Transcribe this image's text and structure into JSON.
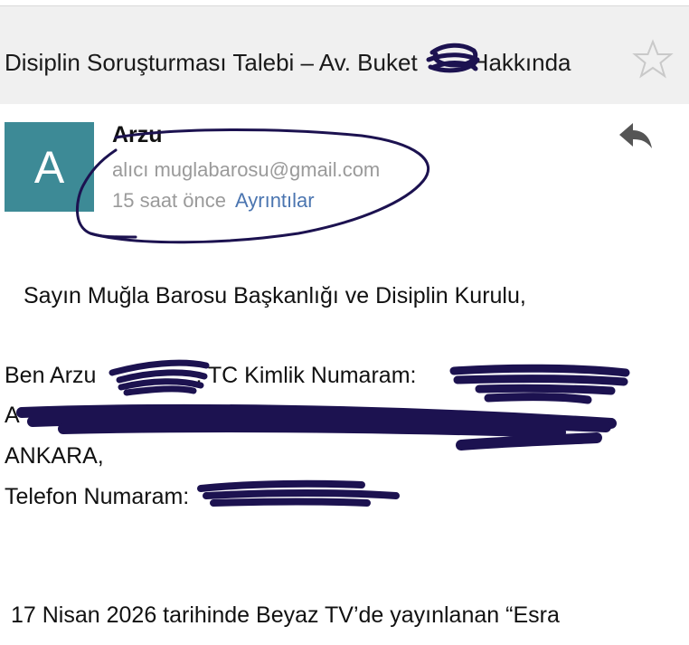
{
  "subject": {
    "text_before": "Disiplin Soruşturması Talebi – Av. Buket",
    "text_after": "Hakkında"
  },
  "icons": {
    "star": "star-outline-icon",
    "reply": "reply-arrow-icon"
  },
  "sender": {
    "avatar_letter": "A",
    "name": "Arzu",
    "to_prefix": "alıcı",
    "to_address": "muglabarosu@gmail.com",
    "time": "15 saat önce",
    "details_link": "Ayrıntılar"
  },
  "body": {
    "greeting": "Sayın Muğla Barosu Başkanlığı ve Disiplin Kurulu,",
    "line1_before": "Ben Arzu",
    "line1_middle": ", TC Kimlik Numaram:",
    "line2_start": "A",
    "line3": "ANKARA,",
    "line4": "Telefon Numaram:",
    "paragraph_start": "17 Nisan 2026 tarihinde Beyaz TV’de yayınlanan “Esra"
  },
  "colors": {
    "subject_bg": "#f0f0f0",
    "avatar_bg": "#3d8a96",
    "link": "#4b75b0",
    "muted": "#9a9a9a",
    "redaction_ink": "#1c1250"
  }
}
